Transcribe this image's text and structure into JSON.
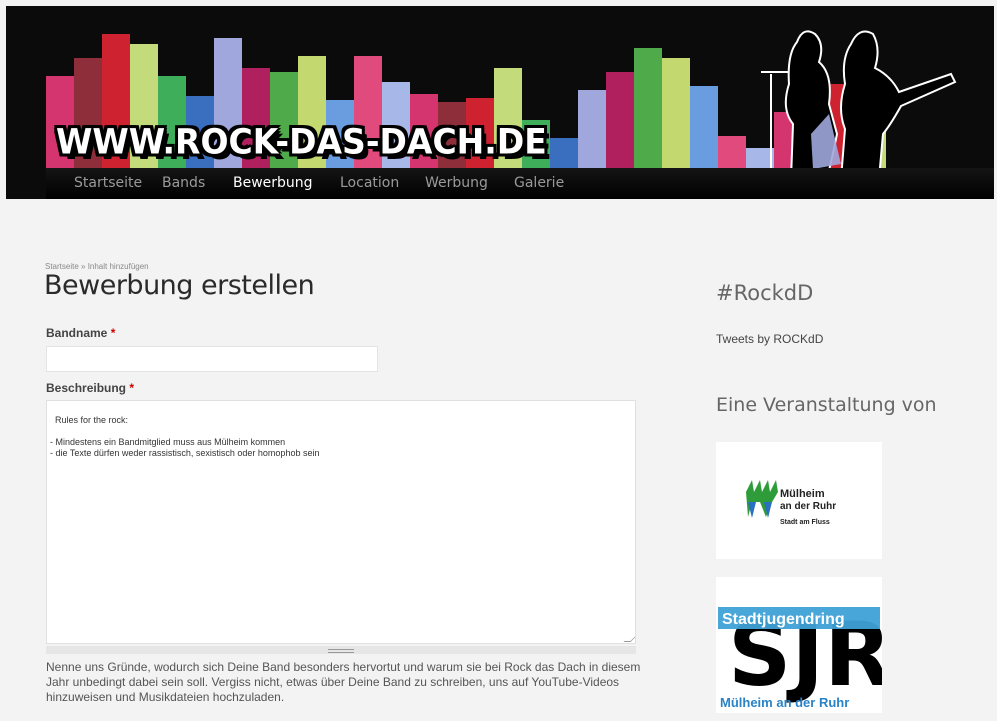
{
  "site": {
    "logo_text": "WWW.ROCK-DAS-DACH.DE",
    "nav": [
      {
        "label": "Startseite",
        "active": false
      },
      {
        "label": "Bands",
        "active": false
      },
      {
        "label": "Bewerbung",
        "active": true
      },
      {
        "label": "Location",
        "active": false
      },
      {
        "label": "Werbung",
        "active": false
      },
      {
        "label": "Galerie",
        "active": false
      }
    ]
  },
  "main": {
    "breadcrumb": "Startseite » Inhalt hinzufügen",
    "title": "Bewerbung erstellen",
    "fields": {
      "bandname": {
        "label": "Bandname",
        "required_mark": "*",
        "value": ""
      },
      "beschreibung": {
        "label": "Beschreibung",
        "required_mark": "*",
        "value": "Rules for the rock:\n\n- Mindestens ein Bandmitglied muss aus Mülheim kommen\n- die Texte dürfen weder rassistisch, sexistisch oder homophob sein"
      }
    },
    "help_text": "Nenne uns Gründe, wodurch sich Deine Band besonders hervortut und warum sie bei Rock das Dach in diesem Jahr unbedingt dabei sein soll. Vergiss nicht, etwas über Deine Band zu schreiben, uns auf YouTube-Videos hinzuweisen und Musikdateien hochzuladen."
  },
  "sidebar": {
    "hashtag_title": "#RockdD",
    "tweets_link": "Tweets by ROCKdD",
    "event_title": "Eine Veranstaltung von",
    "sponsors": [
      {
        "name": "Mülheim an der Ruhr Stadt am Fluss",
        "line1": "Mülheim",
        "line2": "an der Ruhr",
        "line3": "Stadt am Fluss"
      },
      {
        "name": "Stadtjugendring Mülheim an der Ruhr",
        "top": "Stadtjugendring",
        "bottom": "Mülheim an der Ruhr",
        "letters": "SJR"
      }
    ]
  },
  "colors": {
    "bar_palette": [
      "#d4356f",
      "#8e2e3a",
      "#cf2230",
      "#c3db7a",
      "#3fae5a",
      "#3a6fbf",
      "#9fa7dd",
      "#b0205f",
      "#4faa4a",
      "#c3d96f",
      "#6a9de0",
      "#e04a7d",
      "#a7b8e8"
    ]
  }
}
